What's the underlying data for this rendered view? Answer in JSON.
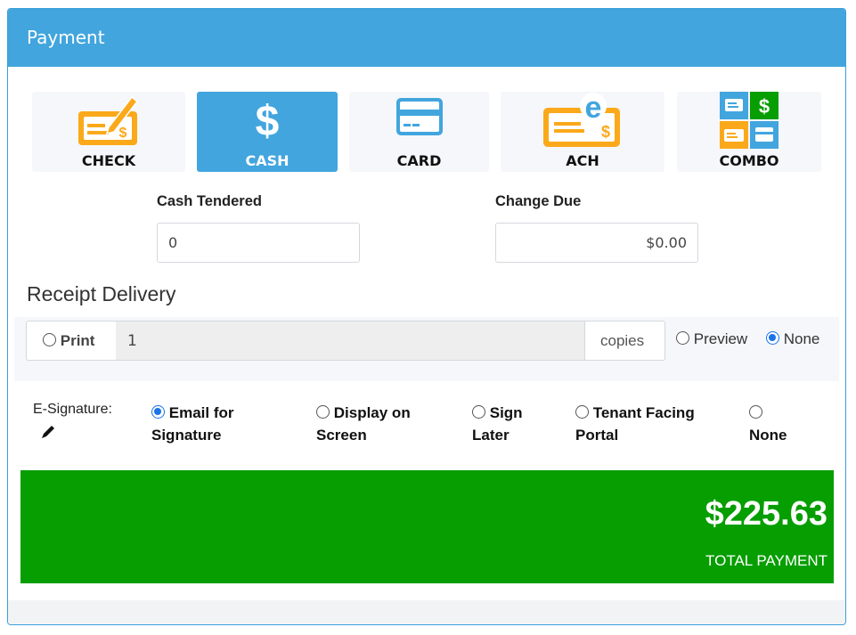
{
  "panel": {
    "title": "Payment"
  },
  "methods": [
    {
      "label": "CHECK",
      "icon": "check-icon",
      "active": false
    },
    {
      "label": "CASH",
      "icon": "dollar-icon",
      "active": true
    },
    {
      "label": "CARD",
      "icon": "card-icon",
      "active": false
    },
    {
      "label": "ACH",
      "icon": "ach-icon",
      "active": false
    },
    {
      "label": "COMBO",
      "icon": "combo-icon",
      "active": false
    }
  ],
  "cash": {
    "tendered_label": "Cash Tendered",
    "tendered_value": "0",
    "change_label": "Change Due",
    "change_value": "$0.00"
  },
  "receipt": {
    "title": "Receipt Delivery",
    "print_label": "Print",
    "copies_value": "1",
    "copies_suffix": "copies",
    "preview_label": "Preview",
    "none_label": "None",
    "selected": "None"
  },
  "esignature": {
    "label": "E-Signature:",
    "options": [
      {
        "line1": "Email for",
        "line2": "Signature",
        "selected": true
      },
      {
        "line1": "Display on",
        "line2": "Screen",
        "selected": false
      },
      {
        "line1": "Sign",
        "line2": "Later",
        "selected": false
      },
      {
        "line1": "Tenant Facing",
        "line2": "Portal",
        "selected": false
      },
      {
        "line1": "",
        "line2": "None",
        "selected": false
      }
    ]
  },
  "total": {
    "amount": "$225.63",
    "caption": "TOTAL PAYMENT"
  },
  "colors": {
    "header": "#42a5de",
    "active_method": "#42a5de",
    "total_bg": "#069e00",
    "icon_orange": "#fba91a"
  }
}
